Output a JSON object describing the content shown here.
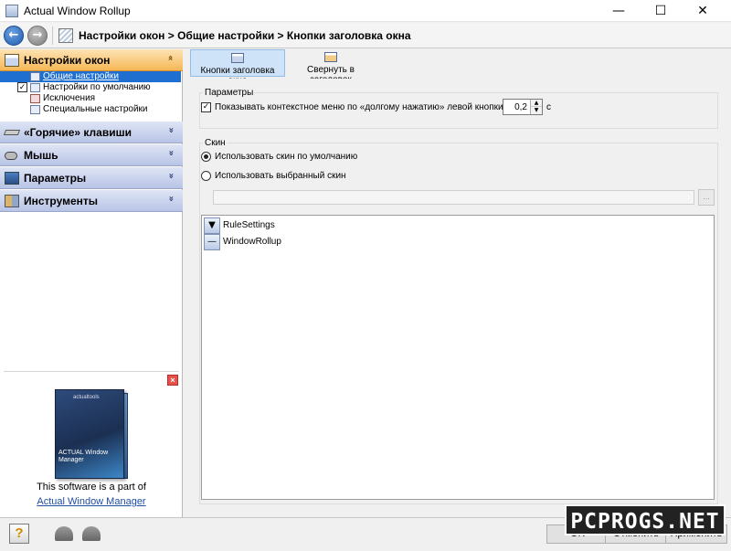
{
  "window": {
    "title": "Actual Window Rollup",
    "minimize_glyph": "—",
    "maximize_glyph": "☐",
    "close_glyph": "✕"
  },
  "nav": {
    "back_glyph": "←",
    "forward_glyph": "→",
    "breadcrumb": "Настройки окон > Общие настройки > Кнопки заголовка окна"
  },
  "sidebar": {
    "groups": [
      {
        "label": "Настройки окон",
        "chevron": "»"
      },
      {
        "label": "«Горячие» клавиши",
        "chevron": "»"
      },
      {
        "label": "Мышь",
        "chevron": "»"
      },
      {
        "label": "Параметры",
        "chevron": "»"
      },
      {
        "label": "Инструменты",
        "chevron": "»"
      }
    ],
    "tree": [
      {
        "label": "Общие настройки"
      },
      {
        "label": "Настройки по умолчанию",
        "check": "✓"
      },
      {
        "label": "Исключения"
      },
      {
        "label": "Специальные настройки"
      }
    ],
    "promo": {
      "close_glyph": "×",
      "box_brand": "actualtools",
      "box_text": "ACTUAL Window Manager",
      "text": "This software is a part of",
      "link": "Actual Window Manager"
    }
  },
  "tabs": [
    {
      "label": "Кнопки заголовка окна"
    },
    {
      "label": "Свернуть в заголовок"
    }
  ],
  "params": {
    "legend": "Параметры",
    "longpress_check": "✓",
    "longpress_label": "Показывать контекстное меню по «долгому нажатию» левой кнопки мыши",
    "longpress_value": "0,2",
    "spin_up": "▲",
    "spin_down": "▼",
    "longpress_unit": "с"
  },
  "skin": {
    "legend": "Скин",
    "default_label": "Использовать скин по умолчанию",
    "chosen_label": "Использовать выбранный скин",
    "browse_label": "...",
    "items": [
      {
        "icon": "▼",
        "label": "RuleSettings"
      },
      {
        "icon": "—",
        "label": "WindowRollup"
      }
    ]
  },
  "footer": {
    "help_glyph": "?",
    "ok": "OK",
    "cancel": "Отменить",
    "apply": "Применить"
  },
  "watermark": "PCPROGS.NET"
}
